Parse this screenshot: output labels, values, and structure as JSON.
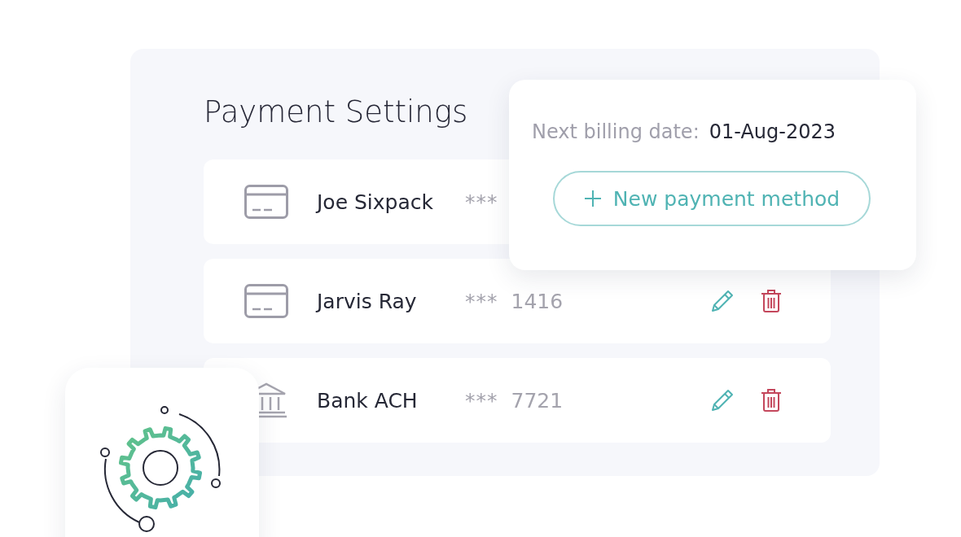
{
  "panel": {
    "title": "Payment Settings"
  },
  "methods": [
    {
      "kind": "card",
      "name": "Joe Sixpack",
      "mask": "***"
    },
    {
      "kind": "card",
      "name": "Jarvis Ray",
      "mask": "***",
      "last4": "1416"
    },
    {
      "kind": "bank",
      "name": "Bank ACH",
      "mask": "***",
      "last4": "7721"
    }
  ],
  "billing": {
    "label": "Next billing date:",
    "date": "01-Aug-2023",
    "button": "New payment method"
  }
}
